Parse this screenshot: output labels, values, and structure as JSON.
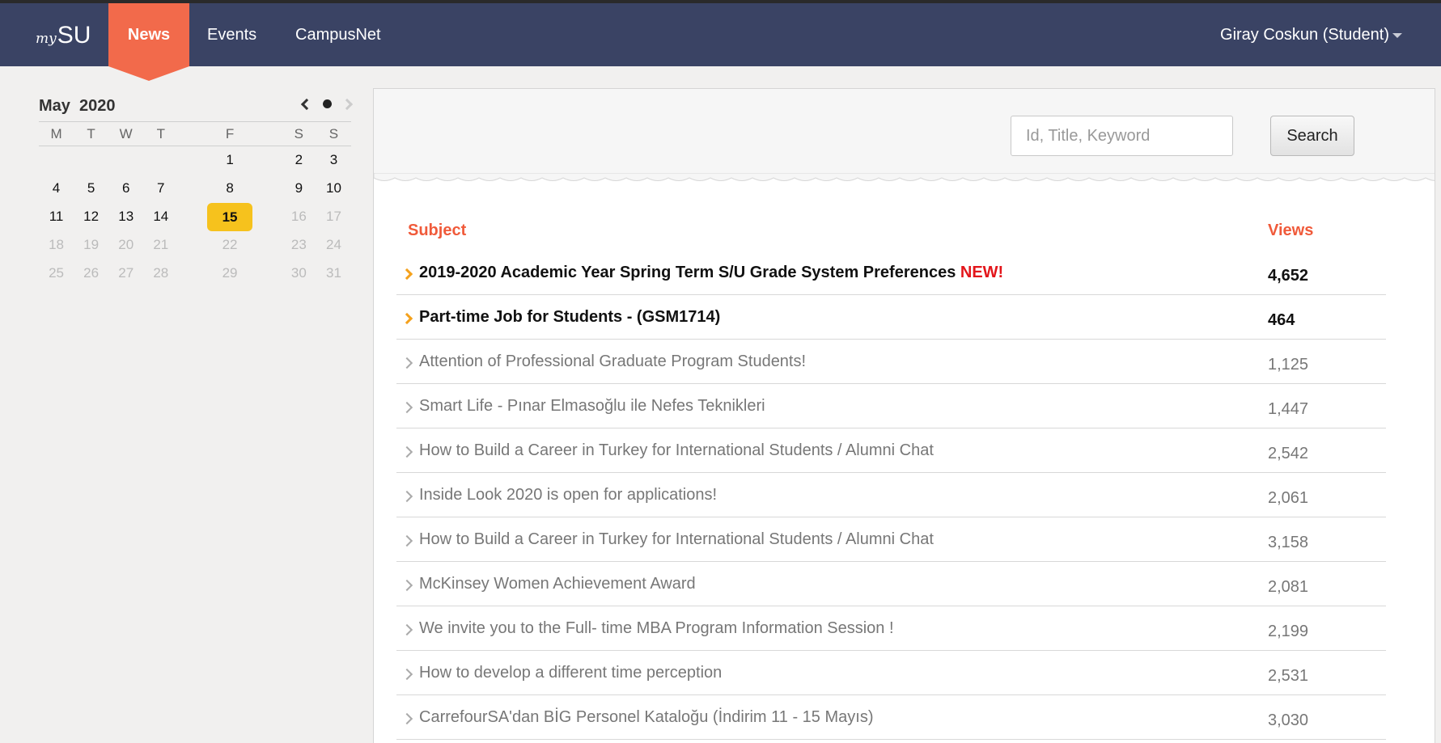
{
  "nav": {
    "logo_prefix": "my",
    "logo_main": "SU",
    "items": [
      {
        "label": "News"
      },
      {
        "label": "Events"
      },
      {
        "label": "CampusNet"
      }
    ],
    "user": "Giray Coskun (Student)",
    "colors": {
      "bar": "#3a4364",
      "active": "#f26a4b"
    }
  },
  "calendar": {
    "month": "May",
    "year": "2020",
    "weekdays": [
      "M",
      "T",
      "W",
      "T",
      "F",
      "S",
      "S"
    ],
    "weeks": [
      [
        "",
        "",
        "",
        "",
        "1",
        "2",
        "3"
      ],
      [
        "4",
        "5",
        "6",
        "7",
        "8",
        "9",
        "10"
      ],
      [
        "11",
        "12",
        "13",
        "14",
        "15",
        "16",
        "17"
      ],
      [
        "18",
        "19",
        "20",
        "21",
        "22",
        "23",
        "24"
      ],
      [
        "25",
        "26",
        "27",
        "28",
        "29",
        "30",
        "31"
      ]
    ],
    "today": "15",
    "today_color": "#f6c21d"
  },
  "search": {
    "placeholder": "Id, Title, Keyword",
    "button": "Search"
  },
  "list": {
    "header_subject": "Subject",
    "header_views": "Views",
    "rows": [
      {
        "title": "2019-2020 Academic Year Spring Term S/U Grade System Preferences",
        "badge": "NEW!",
        "views": "4,652",
        "highlight": true
      },
      {
        "title": "Part-time Job for Students - (GSM1714)",
        "badge": "",
        "views": "464",
        "highlight": true
      },
      {
        "title": "Attention of Professional Graduate Program Students!",
        "badge": "",
        "views": "1,125",
        "highlight": false
      },
      {
        "title": "Smart Life - Pınar Elmasoğlu ile Nefes Teknikleri",
        "badge": "",
        "views": "1,447",
        "highlight": false
      },
      {
        "title": "How to Build a Career in Turkey for International Students / Alumni Chat",
        "badge": "",
        "views": "2,542",
        "highlight": false
      },
      {
        "title": "Inside Look 2020 is open for applications!",
        "badge": "",
        "views": "2,061",
        "highlight": false
      },
      {
        "title": "How to Build a Career in Turkey for International Students / Alumni Chat",
        "badge": "",
        "views": "3,158",
        "highlight": false
      },
      {
        "title": "McKinsey Women Achievement Award",
        "badge": "",
        "views": "2,081",
        "highlight": false
      },
      {
        "title": "We invite you to the Full- time MBA Program Information Session !",
        "badge": "",
        "views": "2,199",
        "highlight": false
      },
      {
        "title": "How to develop a different time perception",
        "badge": "",
        "views": "2,531",
        "highlight": false
      },
      {
        "title": "CarrefourSA'dan BİG Personel Kataloğu (İndirim 11 - 15 Mayıs)",
        "badge": "",
        "views": "3,030",
        "highlight": false
      }
    ]
  }
}
